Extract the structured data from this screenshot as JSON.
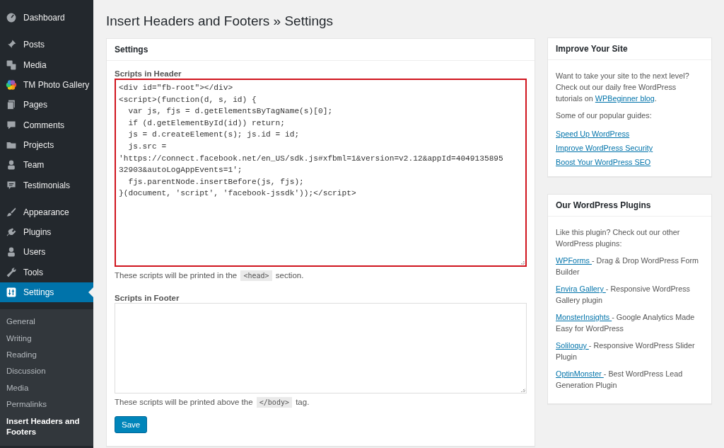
{
  "sidebar": {
    "groups": [
      [
        {
          "label": "Dashboard",
          "selected": false
        }
      ],
      [
        {
          "label": "Posts",
          "selected": false
        },
        {
          "label": "Media",
          "selected": false
        },
        {
          "label": "TM Photo Gallery",
          "selected": false
        },
        {
          "label": "Pages",
          "selected": false
        },
        {
          "label": "Comments",
          "selected": false
        },
        {
          "label": "Projects",
          "selected": false
        },
        {
          "label": "Team",
          "selected": false
        },
        {
          "label": "Testimonials",
          "selected": false
        }
      ],
      [
        {
          "label": "Appearance",
          "selected": false
        },
        {
          "label": "Plugins",
          "selected": false
        },
        {
          "label": "Users",
          "selected": false
        },
        {
          "label": "Tools",
          "selected": false
        },
        {
          "label": "Settings",
          "selected": true
        }
      ]
    ],
    "submenu": [
      {
        "label": "General",
        "selected": false
      },
      {
        "label": "Writing",
        "selected": false
      },
      {
        "label": "Reading",
        "selected": false
      },
      {
        "label": "Discussion",
        "selected": false
      },
      {
        "label": "Media",
        "selected": false
      },
      {
        "label": "Permalinks",
        "selected": false
      },
      {
        "label": "Insert Headers and Footers",
        "selected": true
      }
    ]
  },
  "page_title": "Insert Headers and Footers » Settings",
  "settings_panel": {
    "title": "Settings",
    "header_scripts": {
      "label": "Scripts in Header",
      "highlighted": true,
      "lines": [
        "<div id=\"fb-root\"></div>",
        "<script>(function(d, s, id) {",
        "  var js, fjs = d.getElementsByTagName(s)[0];",
        "  if (d.getElementById(id)) return;",
        "  js = d.createElement(s); js.id = id;",
        "  js.src =",
        "'https://connect.facebook.net/en_US/sdk.js#xfbml=1&version=v2.12&appId=4049135895",
        "32903&autoLogAppEvents=1';",
        "  fjs.parentNode.insertBefore(js, fjs);",
        "}(document, 'script', 'facebook-jssdk'));</script>"
      ],
      "hint": {
        "before": "These scripts will be printed in the",
        "code": "<head>",
        "after": "section."
      }
    },
    "footer_scripts": {
      "label": "Scripts in Footer",
      "highlighted": false,
      "hint": {
        "before": "These scripts will be printed above the",
        "code": "</body>",
        "after": "tag."
      }
    },
    "save_button": "Save"
  },
  "improve_box": {
    "title": "Improve Your Site",
    "intro": {
      "before": "Want to take your site to the next level? Check out our daily free WordPress tutorials on ",
      "link": "WPBeginner blog",
      "after": "."
    },
    "guides_intro": "Some of our popular guides:",
    "guides": [
      "Speed Up WordPress",
      "Improve WordPress Security",
      "Boost Your WordPress SEO"
    ]
  },
  "plugins_box": {
    "title": "Our WordPress Plugins",
    "intro": "Like this plugin? Check out our other WordPress plugins:",
    "plugins": [
      {
        "link": "WPForms ",
        "text": "- Drag & Drop WordPress Form Builder"
      },
      {
        "link": "Envira Gallery ",
        "text": "- Responsive WordPress Gallery plugin"
      },
      {
        "link": "MonsterInsights ",
        "text": "- Google Analytics Made Easy for WordPress"
      },
      {
        "link": "Soliloquy ",
        "text": "- Responsive WordPress Slider Plugin"
      },
      {
        "link": "OptinMonster ",
        "text": "- Best WordPress Lead Generation Plugin"
      }
    ]
  }
}
